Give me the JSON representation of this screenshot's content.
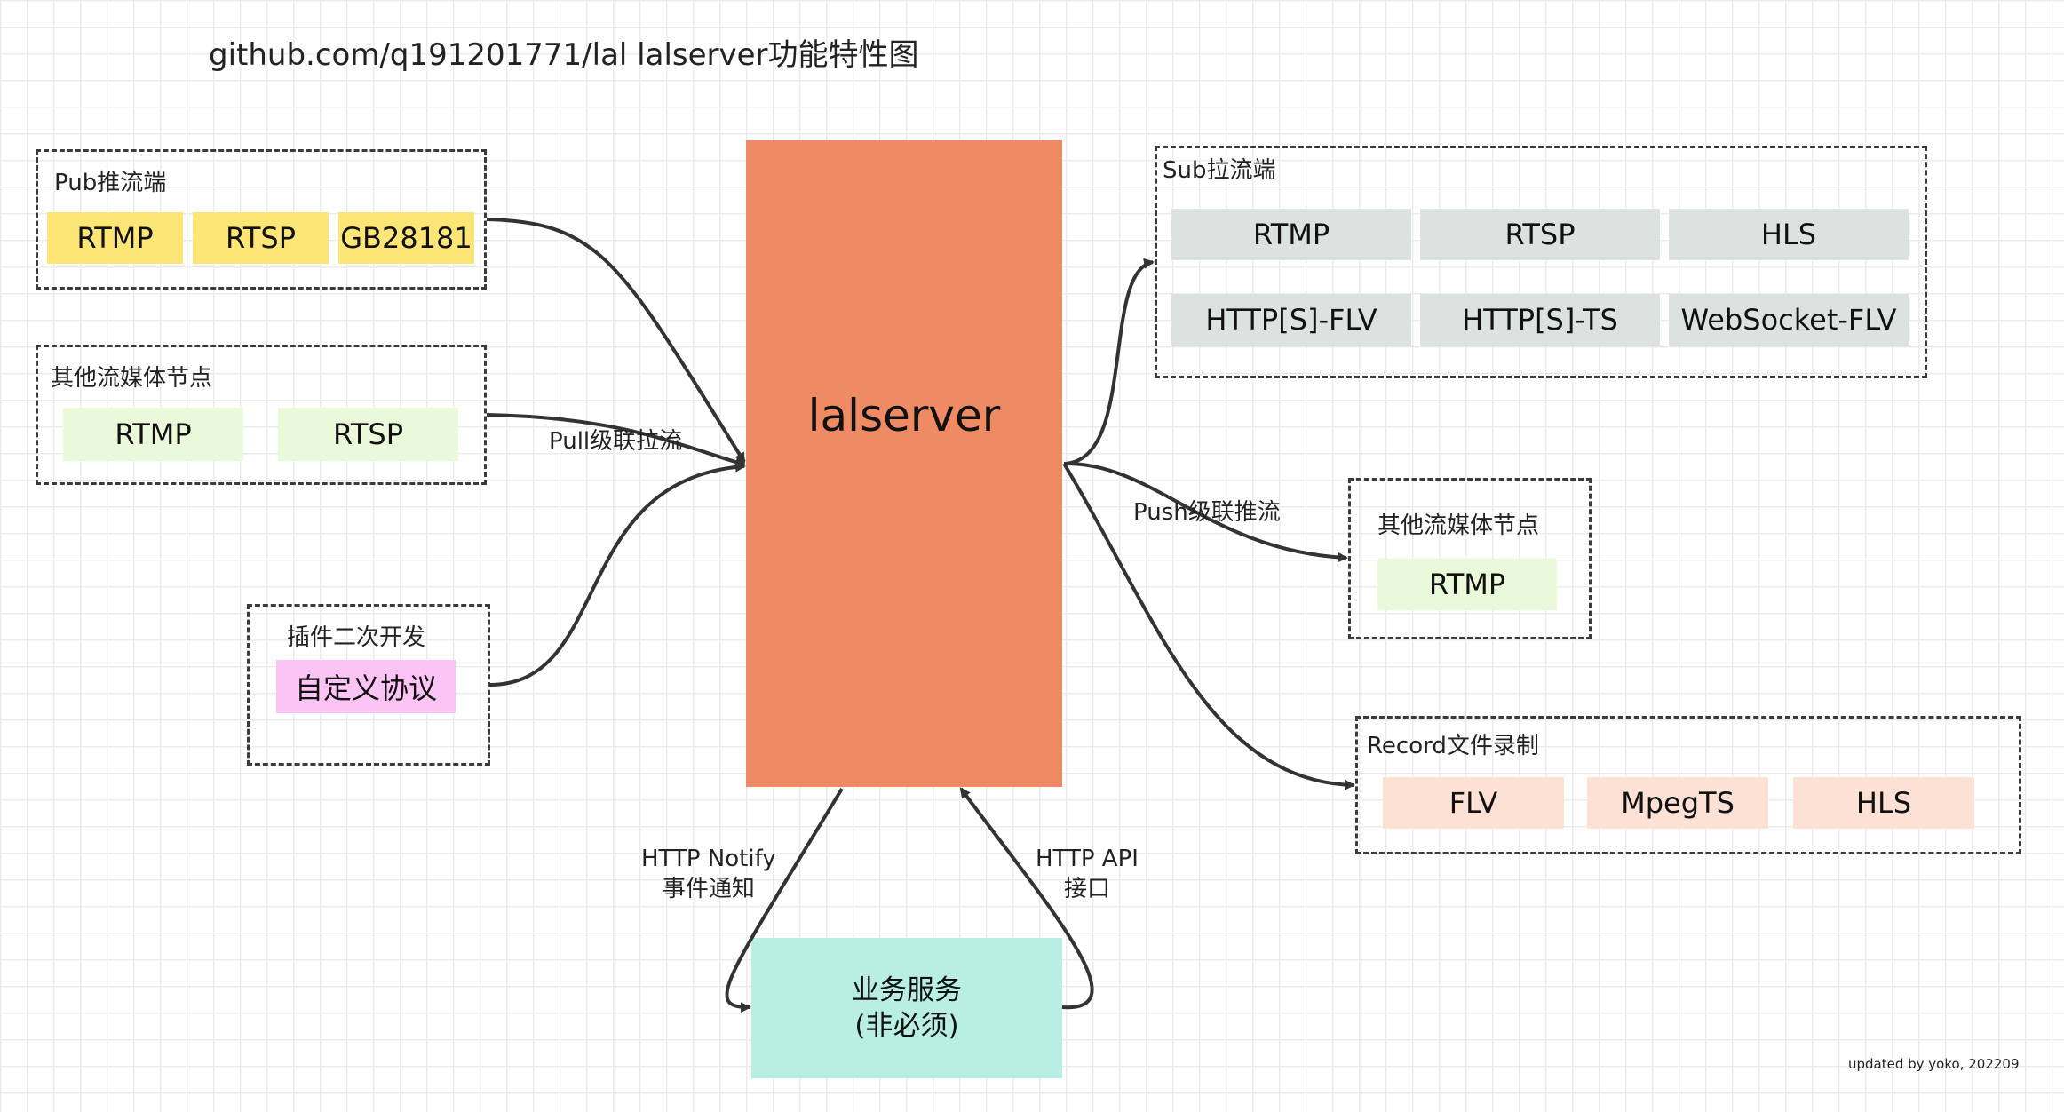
{
  "title": "github.com/q191201771/lal lalserver功能特性图",
  "core": {
    "label": "lalserver"
  },
  "groups": {
    "pub": {
      "label": "Pub推流端",
      "items": [
        "RTMP",
        "RTSP",
        "GB28181"
      ]
    },
    "other_pull": {
      "label": "其他流媒体节点",
      "items": [
        "RTMP",
        "RTSP"
      ]
    },
    "plugin": {
      "label": "插件二次开发",
      "items": [
        "自定义协议"
      ]
    },
    "sub": {
      "label": "Sub拉流端",
      "items": [
        "RTMP",
        "RTSP",
        "HLS",
        "HTTP[S]-FLV",
        "HTTP[S]-TS",
        "WebSocket-FLV"
      ]
    },
    "other_push": {
      "label": "其他流媒体节点",
      "items": [
        "RTMP"
      ]
    },
    "record": {
      "label": "Record文件录制",
      "items": [
        "FLV",
        "MpegTS",
        "HLS"
      ]
    }
  },
  "business": {
    "line1": "业务服务",
    "line2": "(非必须)"
  },
  "edges": {
    "pull": "Pull级联拉流",
    "push": "Push级联推流",
    "notify_line1": "HTTP Notify",
    "notify_line2": "事件通知",
    "api_line1": "HTTP API",
    "api_line2": "接口"
  },
  "footer": "updated by yoko, 202209",
  "colors": {
    "core": "#ef8b64",
    "business": "#b9efe3",
    "pub_chip": "#fde676",
    "node_chip": "#e9f9d9",
    "plugin_chip": "#fcc4f5",
    "sub_chip": "#dbe2df",
    "record_chip": "#fde1d5"
  }
}
